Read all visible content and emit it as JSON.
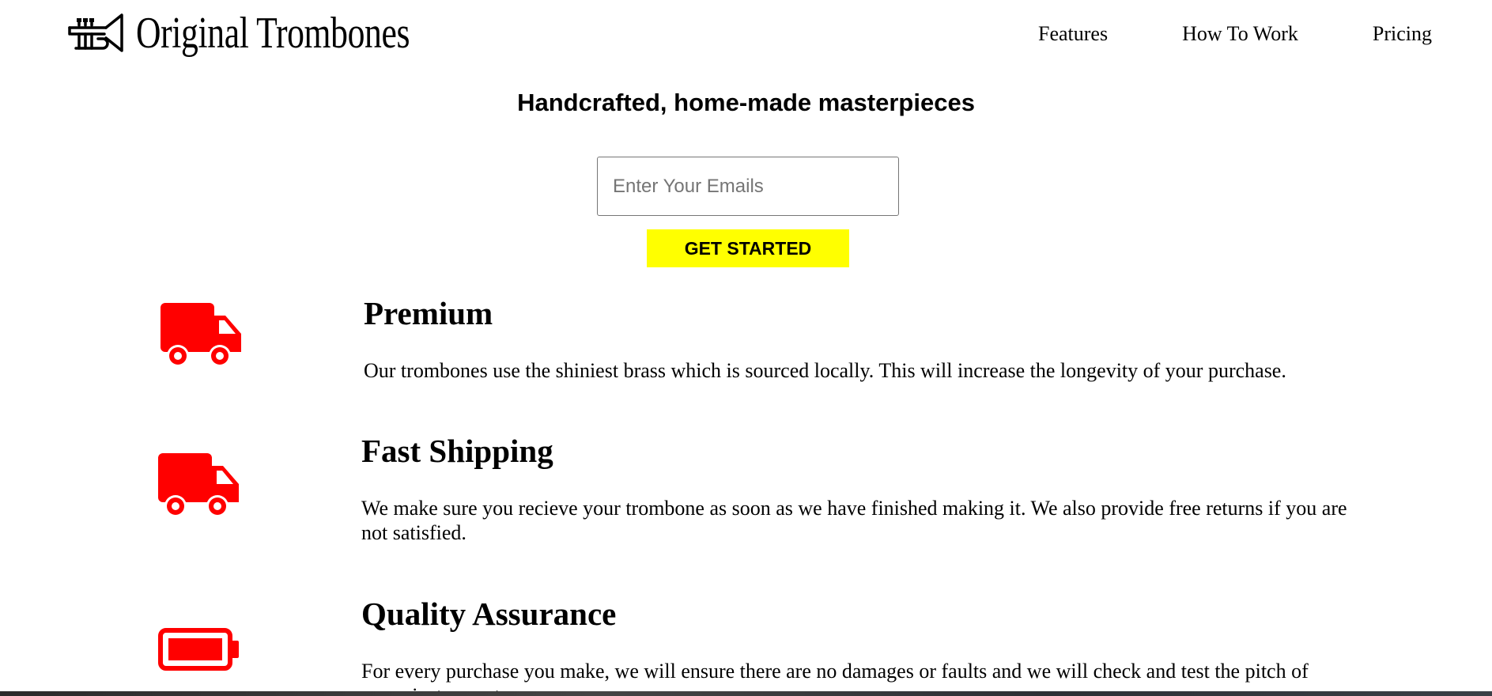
{
  "brand": {
    "name": "Original Trombones",
    "icon": "trumpet-icon"
  },
  "nav": {
    "items": [
      "Features",
      "How To Work",
      "Pricing"
    ]
  },
  "hero": {
    "title": "Handcrafted, home-made masterpieces",
    "email_placeholder": "Enter Your Emails",
    "email_value": "",
    "cta_label": "GET STARTED"
  },
  "features": [
    {
      "icon": "truck-icon",
      "title": "Premium",
      "description": "Our trombones use the shiniest brass which is sourced locally. This will increase the longevity of your purchase."
    },
    {
      "icon": "truck-icon",
      "title": "Fast Shipping",
      "description": "We make sure you recieve your trombone as soon as we have finished making it. We also provide free returns if you are not satisfied."
    },
    {
      "icon": "battery-icon",
      "title": "Quality Assurance",
      "description": "For every purchase you make, we will ensure there are no damages or faults and we will check and test the pitch of every instrument."
    }
  ],
  "colors": {
    "accent": "#ff0000",
    "cta_background": "#ffff00",
    "text": "#000000",
    "background": "#ffffff"
  }
}
